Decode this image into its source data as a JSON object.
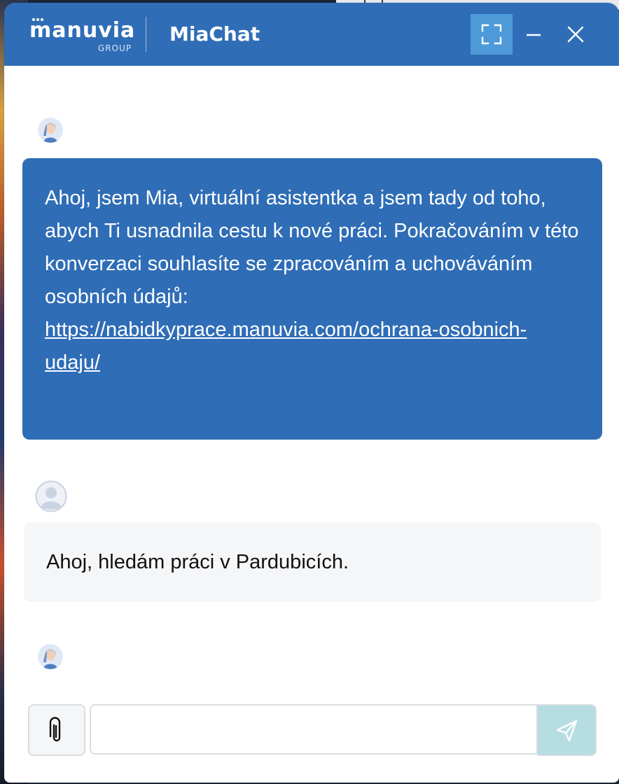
{
  "header": {
    "logo_text": "manuvia",
    "logo_subtext": "GROUP",
    "title": "MiaChat",
    "expand_icon": "expand-icon",
    "minimize_icon": "minimize-icon",
    "close_icon": "close-icon"
  },
  "messages": [
    {
      "sender": "bot",
      "avatar_icon": "mia-avatar",
      "text": "Ahoj, jsem Mia, virtuální asistentka a jsem tady od toho, abych Ti usnadnila cestu k nové práci. Pokračováním v této konverzaci souhlasíte se zpracováním a uchováváním osobních údajů: ",
      "link_text": "https://nabidkyprace.manuvia.com/ochrana-osobnich-udaju/"
    },
    {
      "sender": "user",
      "avatar_icon": "user-avatar-icon",
      "text": "Ahoj, hledám práci v Pardubicích."
    },
    {
      "sender": "bot",
      "avatar_icon": "mia-avatar"
    }
  ],
  "composer": {
    "input_value": "",
    "input_placeholder": "",
    "attach_icon": "paperclip-icon",
    "send_icon": "send-icon"
  },
  "colors": {
    "brand_blue": "#2f6db6",
    "expand_button": "#4e9ad8",
    "user_bubble": "#f5f6f8",
    "send_button": "#b6dde2"
  }
}
